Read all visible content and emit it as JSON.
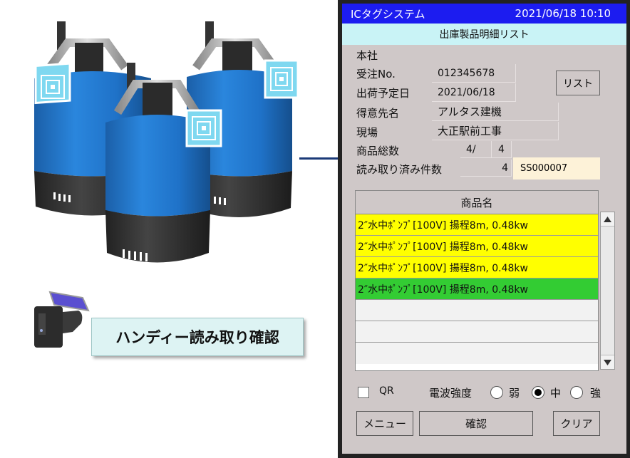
{
  "caption": "ハンディー読み取り確認",
  "device": {
    "app_title": "ICタグシステム",
    "datetime": "2021/06/18 10:10",
    "screen_title": "出庫製品明細リスト",
    "branch": "本社",
    "fields": {
      "order_no_label": "受注No.",
      "order_no": "012345678",
      "ship_date_label": "出荷予定日",
      "ship_date": "2021/06/18",
      "customer_label": "得意先名",
      "customer": "アルタス建機",
      "site_label": "現場",
      "site": "大正駅前工事",
      "total_label": "商品総数",
      "total_read": "4/",
      "total_count": "4",
      "read_label": "読み取り済み件数",
      "read_count": "4",
      "tag_id": "SS000007"
    },
    "list_button": "リスト",
    "table": {
      "header": "商品名",
      "rows": [
        {
          "text": "2″水中ﾎﾟﾝﾌﾟ[100V] 揚程8m, 0.48kw",
          "state": "yellow"
        },
        {
          "text": "2″水中ﾎﾟﾝﾌﾟ[100V] 揚程8m, 0.48kw",
          "state": "yellow"
        },
        {
          "text": "2″水中ﾎﾟﾝﾌﾟ[100V] 揚程8m, 0.48kw",
          "state": "yellow"
        },
        {
          "text": "2″水中ﾎﾟﾝﾌﾟ[100V] 揚程8m, 0.48kw",
          "state": "green"
        },
        {
          "text": "",
          "state": "empty"
        },
        {
          "text": "",
          "state": "empty"
        },
        {
          "text": "",
          "state": "empty"
        }
      ]
    },
    "options": {
      "qr_label": "QR",
      "signal_label": "電波強度",
      "weak": "弱",
      "mid": "中",
      "strong": "強",
      "selected": "mid"
    },
    "buttons": {
      "menu": "メニュー",
      "confirm": "確認",
      "clear": "クリア"
    }
  },
  "colors": {
    "titlebar": "#1c1cf0",
    "subtitle": "#c9f3f6",
    "panel": "#cfc8c8",
    "row_yellow": "#ffff00",
    "row_green": "#33cc33",
    "tag_field": "#fdf2d8",
    "pump_blue": "#1f72c8",
    "pump_dark": "#2f2f2f"
  }
}
